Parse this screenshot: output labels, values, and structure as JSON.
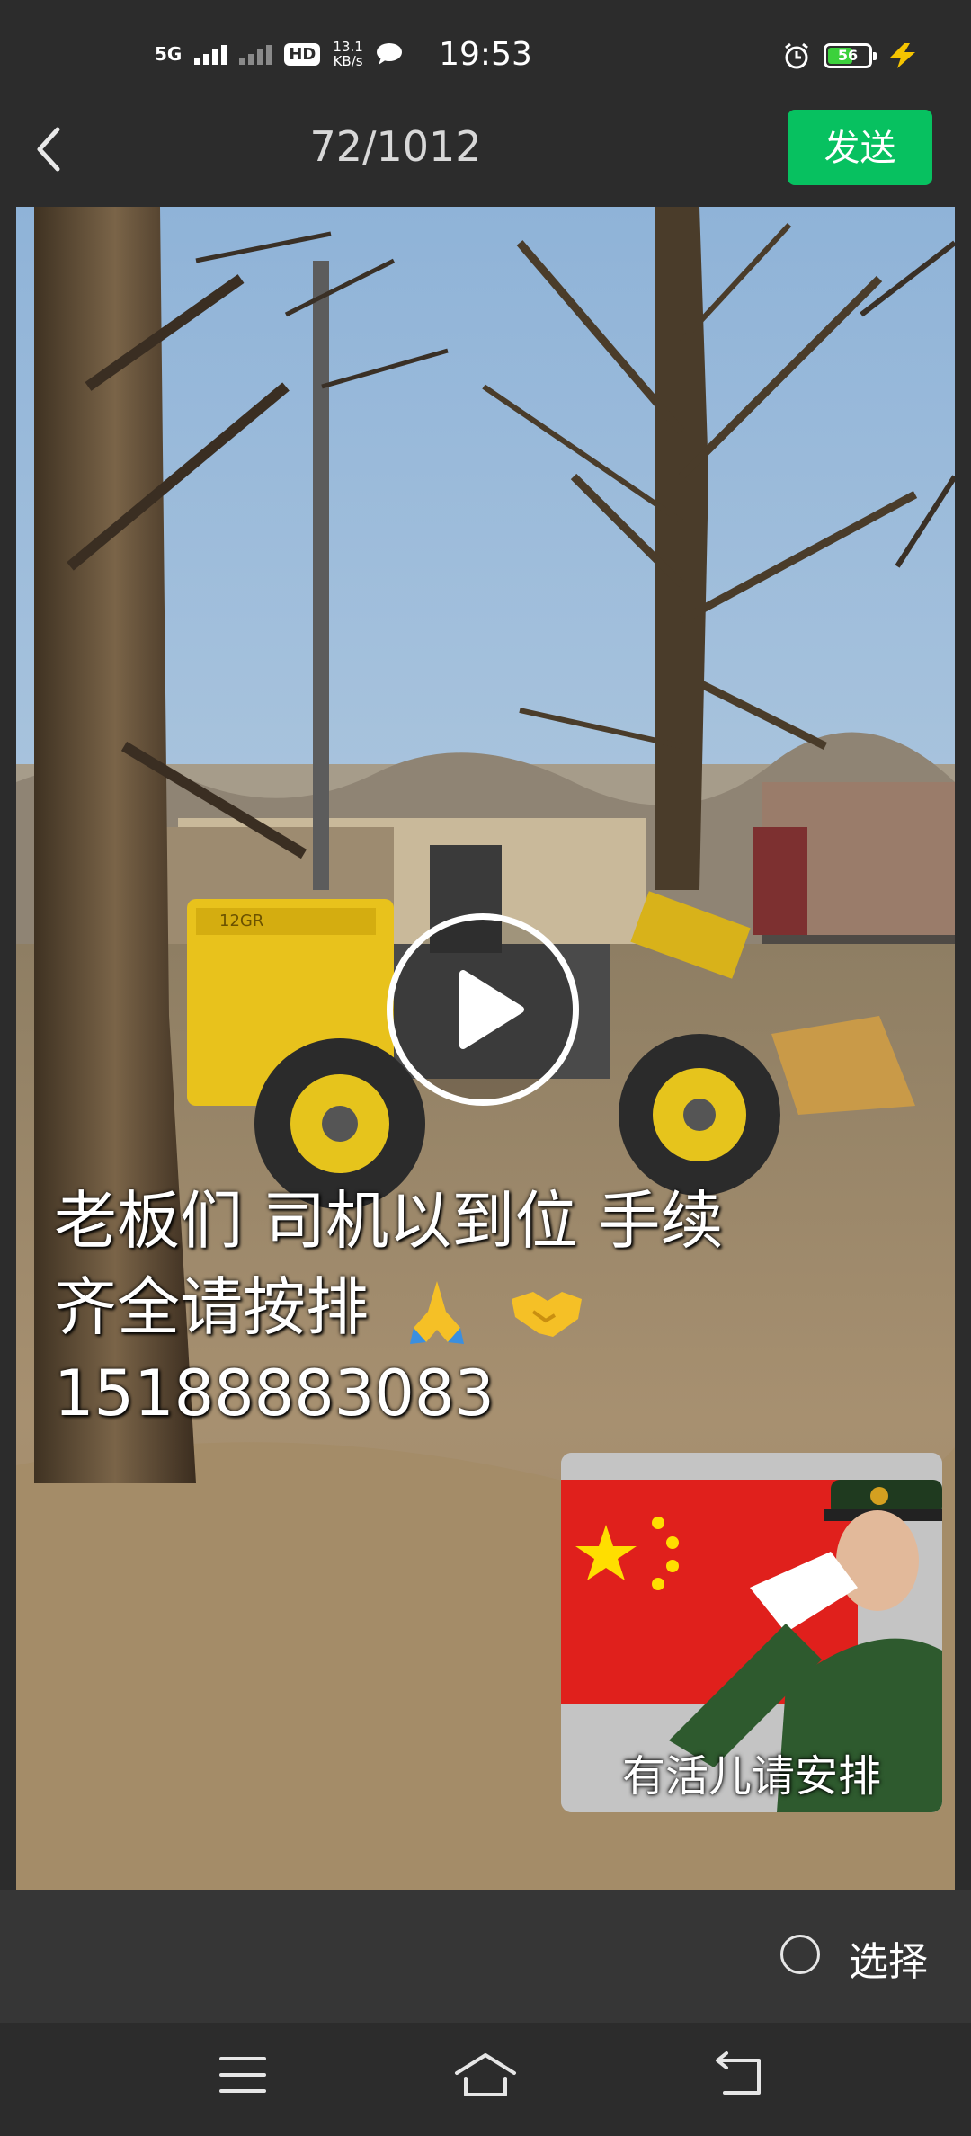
{
  "status_bar": {
    "network": "5G",
    "hd": "HD",
    "hd_sub": "1",
    "speed_value": "13.1",
    "speed_unit": "KB/s",
    "time": "19:53",
    "battery": "56",
    "battery_color": "#3cd13c"
  },
  "header": {
    "counter": "72/1012",
    "send_label": "发送",
    "send_color": "#07c160"
  },
  "media": {
    "caption_line1": "老板们 司机以到位 手续",
    "caption_line2": "齐全请按排",
    "caption_line3": "15188883083",
    "sticker_text": "有活儿请安排",
    "machine_plate": "12GR"
  },
  "select": {
    "label": "选择"
  },
  "icons": {
    "back": "chevron-left-icon",
    "play": "play-icon",
    "menu": "menu-icon",
    "home": "home-icon",
    "return": "return-icon"
  }
}
